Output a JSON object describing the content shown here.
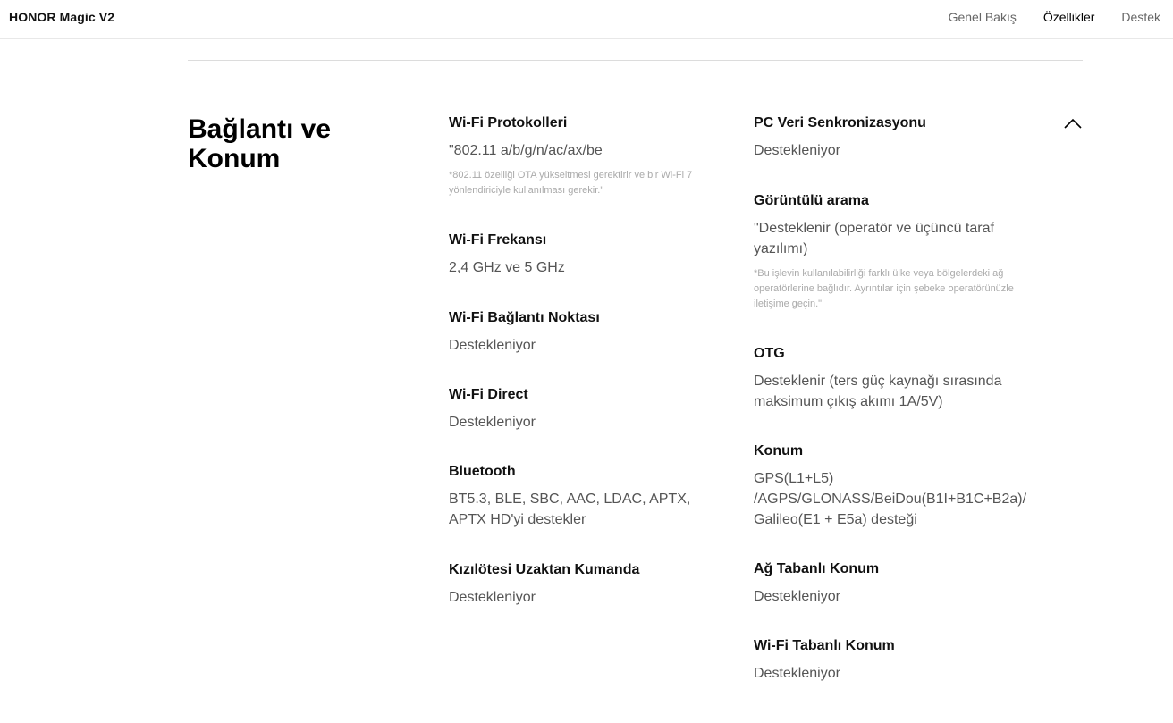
{
  "header": {
    "brand": "HONOR Magic V2",
    "nav": [
      {
        "label": "Genel Bakış",
        "active": false
      },
      {
        "label": "Özellikler",
        "active": true
      },
      {
        "label": "Destek",
        "active": false
      }
    ]
  },
  "section": {
    "title_line1": "Bağlantı ve",
    "title_line2": "Konum",
    "collapse_icon": "chevron-up-icon"
  },
  "left_specs": [
    {
      "title": "Wi-Fi Protokolleri",
      "value": "\"802.11 a/b/g/n/ac/ax/be",
      "note": "*802.11 özelliği OTA yükseltmesi gerektirir ve bir Wi-Fi 7 yönlendiriciyle kullanılması gerekir.\""
    },
    {
      "title": "Wi-Fi Frekansı",
      "value": "2,4 GHz ve 5 GHz"
    },
    {
      "title": "Wi-Fi Bağlantı Noktası",
      "value": "Destekleniyor"
    },
    {
      "title": "Wi-Fi Direct",
      "value": "Destekleniyor"
    },
    {
      "title": "Bluetooth",
      "value": "BT5.3, BLE, SBC, AAC, LDAC, APTX, APTX HD'yi destekler"
    },
    {
      "title": "Kızılötesi Uzaktan Kumanda",
      "value": "Destekleniyor"
    }
  ],
  "right_specs": [
    {
      "title": "PC Veri Senkronizasyonu",
      "value": "Destekleniyor"
    },
    {
      "title": "Görüntülü arama",
      "value": "\"Desteklenir (operatör ve üçüncü taraf yazılımı)",
      "note": "*Bu işlevin kullanılabilirliği farklı ülke veya bölgelerdeki ağ operatörlerine bağlıdır. Ayrıntılar için şebeke operatörünüzle iletişime geçin.\""
    },
    {
      "title": "OTG",
      "value": "Desteklenir (ters güç kaynağı sırasında maksimum çıkış akımı 1A/5V)"
    },
    {
      "title": "Konum",
      "value": "GPS(L1+L5) /AGPS/GLONASS/BeiDou(B1I+B1C+B2a)/ Galileo(E1 + E5a) desteği"
    },
    {
      "title": "Ağ Tabanlı Konum",
      "value": "Destekleniyor"
    },
    {
      "title": "Wi-Fi Tabanlı Konum",
      "value": "Destekleniyor"
    }
  ]
}
